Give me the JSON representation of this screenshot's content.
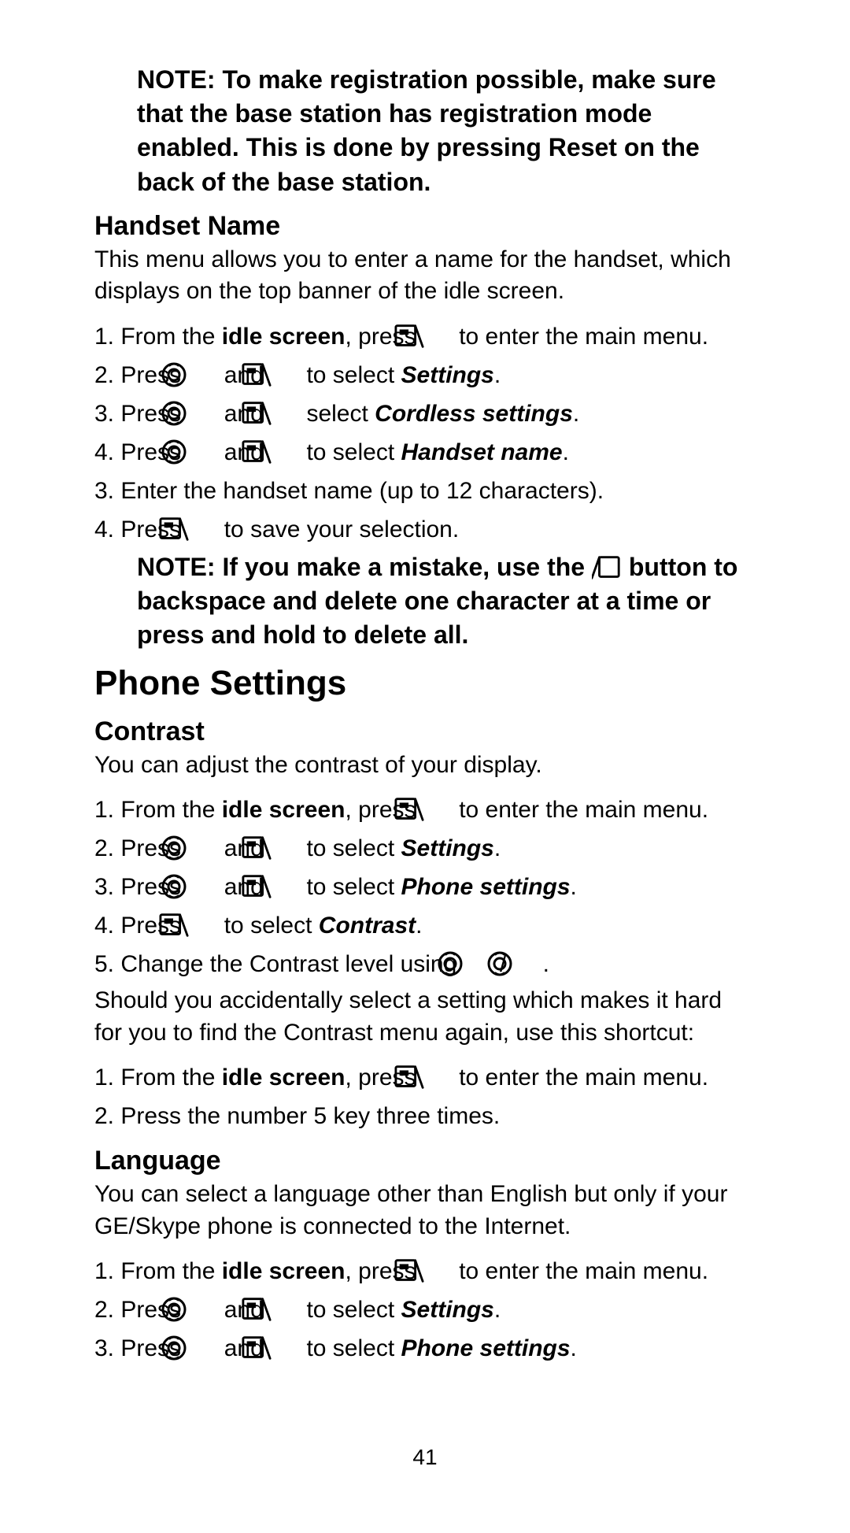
{
  "page_number": "41",
  "note_top": "NOTE: To make registration possible, make sure that the base station has registration mode enabled. This is done by pressing Reset on the back of the base station.",
  "sec_handset": {
    "title": "Handset Name",
    "intro": "This menu allows you to enter a name for the handset, which displays on the top banner of the idle screen.",
    "s1_a": "1.  From the ",
    "s1_b": "idle screen",
    "s1_c": ", press ",
    "s1_d": " to enter the main menu.",
    "s2_a": "2.  Press ",
    "s2_b": " and ",
    "s2_c": " to select ",
    "s2_d": "Settings",
    "s2_e": ".",
    "s3_a": "3.  Press ",
    "s3_b": " and ",
    "s3_c": " select ",
    "s3_d": "Cordless settings",
    "s3_e": ".",
    "s4_a": "4.  Press ",
    "s4_b": " and ",
    "s4_c": " to select ",
    "s4_d": "Handset name",
    "s4_e": ".",
    "s5": "3.  Enter the handset name (up to 12 characters).",
    "s6_a": "4.  Press ",
    "s6_b": " to save your selection.",
    "note_a": "NOTE: If you make a mistake, use the ",
    "note_b": " button to backspace and delete one character at a time or press and hold to delete all."
  },
  "sec_phone": {
    "title": "Phone Settings",
    "contrast": {
      "title": "Contrast",
      "intro": "You can adjust the contrast of your display.",
      "s1_a": "1.  From the ",
      "s1_b": "idle screen",
      "s1_c": ", press ",
      "s1_d": " to enter the main menu.",
      "s2_a": "2.  Press ",
      "s2_b": " and ",
      "s2_c": " to select ",
      "s2_d": "Settings",
      "s2_e": ".",
      "s3_a": "3.  Press ",
      "s3_b": " and ",
      "s3_c": " to select ",
      "s3_d": "Phone settings",
      "s3_e": ".",
      "s4_a": "4.  Press ",
      "s4_b": " to select ",
      "s4_c": "Contrast",
      "s4_d": ".",
      "s5_a": "5.  Change the Contrast level using ",
      "s5_b": " / ",
      "s5_c": ".",
      "shortcut_intro": "Should you accidentally select a setting which makes it hard for you to find the Contrast menu again, use this shortcut:",
      "sc1_a": "1.  From the ",
      "sc1_b": "idle screen",
      "sc1_c": ", press ",
      "sc1_d": " to enter the main menu.",
      "sc2": "2.  Press the number 5 key three times."
    },
    "language": {
      "title": "Language",
      "intro": "You can select a language other than English but only if your GE/Skype phone is connected to the Internet.",
      "s1_a": "1.  From the ",
      "s1_b": "idle screen",
      "s1_c": ", press ",
      "s1_d": " to enter the main menu.",
      "s2_a": "2.  Press ",
      "s2_b": " and ",
      "s2_c": " to select ",
      "s2_d": "Settings",
      "s2_e": ".",
      "s3_a": "3.  Press ",
      "s3_b": " and ",
      "s3_c": " to select ",
      "s3_d": "Phone settings",
      "s3_e": "."
    }
  }
}
